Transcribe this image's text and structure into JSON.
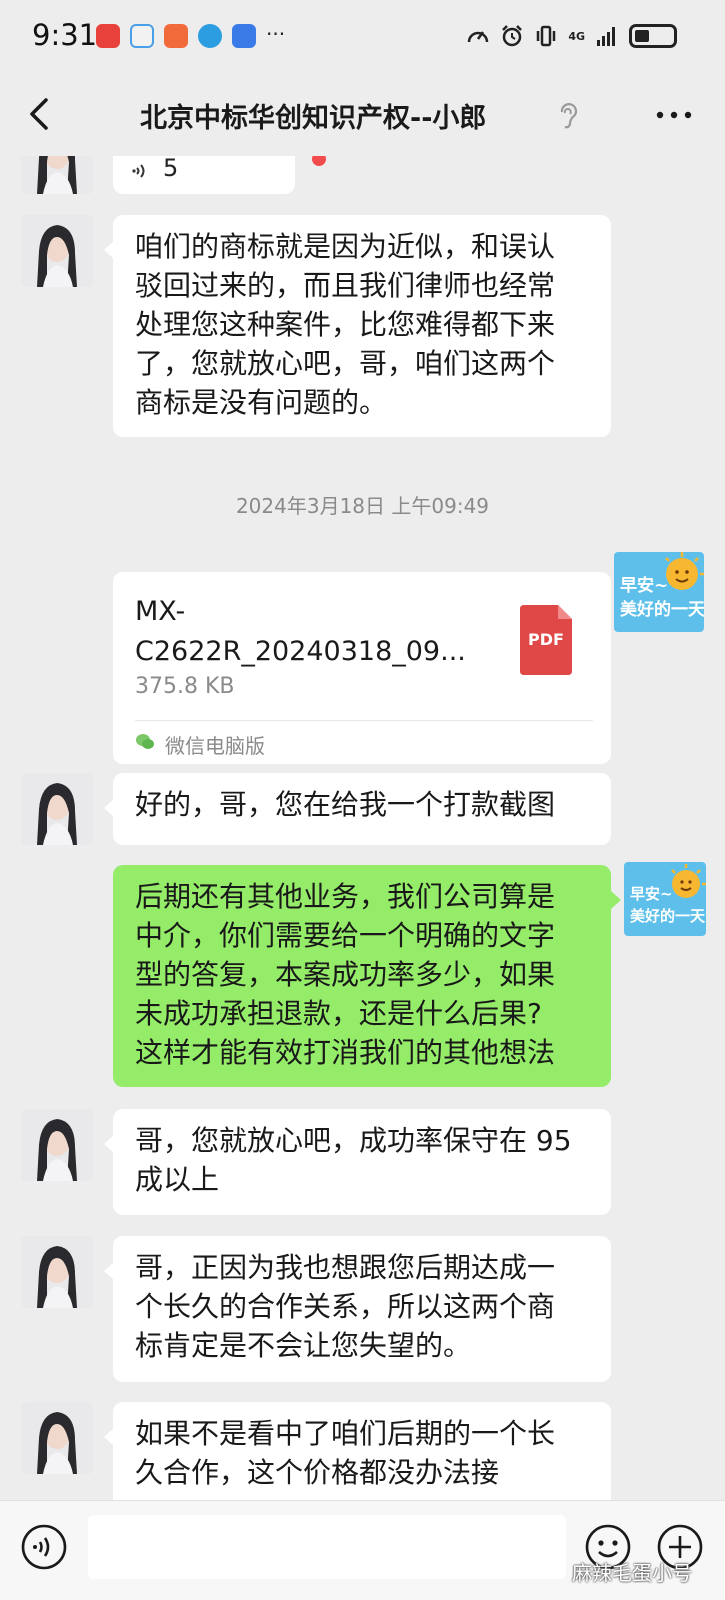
{
  "status_bar": {
    "time": "9:31",
    "network": "4G"
  },
  "header": {
    "title": "北京中标华创知识产权--小郎"
  },
  "messages": {
    "voice": {
      "duration": "5"
    },
    "m1": {
      "lines": [
        "咱们的商标就是因为近似，和误认",
        "驳回过来的，而且我们律师也经常",
        "处理您这种案件，比您难得都下来",
        "了，您就放心吧，哥，咱们这两个",
        "商标是没有问题的。"
      ]
    },
    "timestamp": "2024年3月18日 上午09:49",
    "file": {
      "name_line1": "MX-",
      "name_line2": "C2622R_20240318_09...",
      "size": "375.8 KB",
      "icon_label": "PDF",
      "source": "微信电脑版"
    },
    "m2": {
      "lines": [
        "好的，哥，您在给我一个打款截图"
      ]
    },
    "m3": {
      "lines": [
        "后期还有其他业务，我们公司算是",
        "中介，你们需要给一个明确的文字",
        "型的答复，本案成功率多少，如果",
        "未成功承担退款，还是什么后果?",
        "这样才能有效打消我们的其他想法"
      ]
    },
    "m4": {
      "lines": [
        "哥，您就放心吧，成功率保守在 95",
        "成以上"
      ]
    },
    "m5": {
      "lines": [
        "哥，正因为我也想跟您后期达成一",
        "个长久的合作关系，所以这两个商",
        "标肯定是不会让您失望的。"
      ]
    },
    "m6": {
      "lines": [
        "如果不是看中了咱们后期的一个长",
        "久合作，这个价格都没办法接"
      ]
    }
  },
  "sticker": {
    "line1": "早安~",
    "line2": "美好的一天"
  },
  "input_bar": {
    "placeholder": ""
  },
  "watermark": "麻辣毛蛋小号",
  "colors": {
    "background": "#ededed",
    "sent_bubble": "#95ec69",
    "received_bubble": "#ffffff",
    "pdf_red": "#e04848",
    "sticker_blue": "#5ec0ea"
  }
}
